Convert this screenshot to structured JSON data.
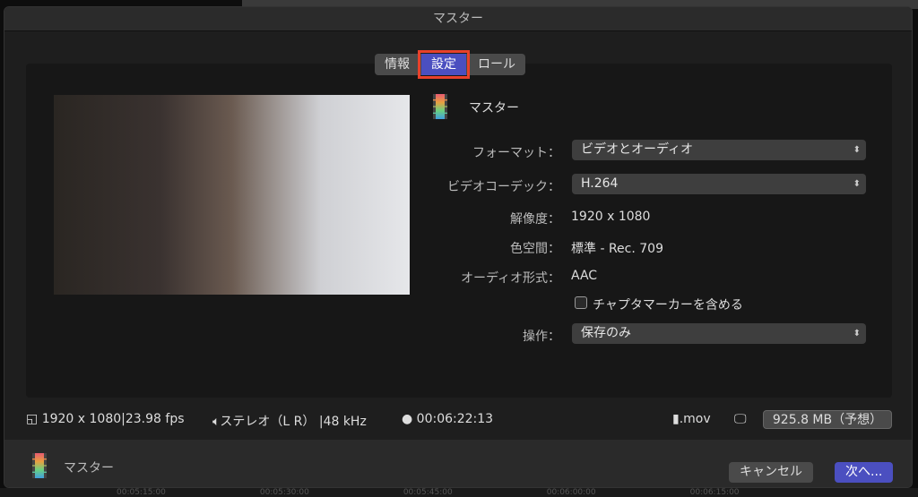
{
  "dialog": {
    "title": "マスター"
  },
  "tabs": [
    {
      "label": "情報"
    },
    {
      "label": "設定",
      "active": true
    },
    {
      "label": "ロール"
    }
  ],
  "preset_name": "マスター",
  "settings": {
    "format": {
      "label": "フォーマット：",
      "value": "ビデオとオーディオ"
    },
    "video_codec": {
      "label": "ビデオコーデック：",
      "value": "H.264"
    },
    "resolution": {
      "label": "解像度：",
      "value": "1920 x 1080"
    },
    "color_space": {
      "label": "色空間：",
      "value": "標準 - Rec. 709"
    },
    "audio_format": {
      "label": "オーディオ形式：",
      "value": "AAC"
    },
    "chapter_markers": {
      "label": "チャプタマーカーを含める",
      "checked": false
    },
    "action": {
      "label": "操作：",
      "value": "保存のみ"
    }
  },
  "status": {
    "resolution": "1920 x 1080",
    "fps": "23.98 fps",
    "audio": "ステレオ（L R）",
    "sample_rate": "48 kHz",
    "duration": "00:06:22:13",
    "extension": ".mov",
    "size": "925.8 MB（予想）"
  },
  "footer": {
    "name": "マスター",
    "cancel": "キャンセル",
    "next": "次へ..."
  },
  "timeline": [
    "00:05:15:00",
    "00:05:30:00",
    "00:05:45:00",
    "00:06:00:00",
    "00:06:15:00"
  ]
}
